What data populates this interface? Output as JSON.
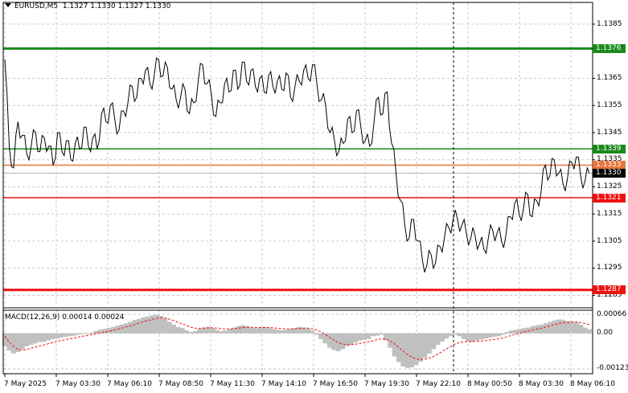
{
  "header": {
    "symbol": "EURUSD,M5",
    "ohlc": "1.1327 1.1330 1.1327 1.1330"
  },
  "macd": {
    "label": "MACD(12,26,9) 0.00014 0.00024",
    "ticks": [
      "0.00066",
      "0.00",
      "-0.00123"
    ]
  },
  "colors": {
    "background": "#ffffff",
    "price_line": "#000000",
    "support_resistance_green": "#1a8a1a",
    "support_resistance_red": "#ee1111",
    "current_price_badge": "#000000",
    "previous_price_line": "#e8743a",
    "macd_histogram": "#c0c0c0",
    "macd_signal": "#ee1111"
  },
  "chart_data": {
    "type": "line",
    "title": "EURUSD,M5",
    "ylim": [
      1.1281,
      1.1393
    ],
    "y_ticks": [
      "1.1385",
      "1.1365",
      "1.1355",
      "1.1345",
      "1.1335",
      "1.1325",
      "1.1315",
      "1.1305",
      "1.1295",
      "1.1285"
    ],
    "x_ticks": [
      "7 May 2025",
      "7 May 03:30",
      "7 May 06:10",
      "7 May 08:50",
      "7 May 11:30",
      "7 May 14:10",
      "7 May 16:50",
      "7 May 19:30",
      "7 May 22:10",
      "8 May 00:50",
      "8 May 03:30",
      "8 May 06:10"
    ],
    "grid": true,
    "levels": [
      {
        "value": 1.1376,
        "label": "1.1376",
        "color": "green",
        "thick": true
      },
      {
        "value": 1.1339,
        "label": "1.1339",
        "color": "green",
        "thick": false
      },
      {
        "value": 1.1333,
        "label": "1.1333",
        "color": "orange",
        "thick": false
      },
      {
        "value": 1.133,
        "label": "1.1330",
        "color": "black",
        "thick": false
      },
      {
        "value": 1.1321,
        "label": "1.1321",
        "color": "red",
        "thick": false
      },
      {
        "value": 1.1287,
        "label": "1.1287",
        "color": "red",
        "thick": true
      }
    ],
    "vline_index": 8,
    "series": [
      {
        "values": [
          1.1372,
          1.134,
          1.1332,
          1.1349,
          1.1344,
          1.1337,
          1.134,
          1.1345,
          1.1338,
          1.1343,
          1.134,
          1.1333,
          1.1345,
          1.1338,
          1.1342,
          1.1335,
          1.1341,
          1.1339,
          1.1347,
          1.134,
          1.1343,
          1.1339,
          1.1352,
          1.1349,
          1.1355,
          1.135,
          1.1346,
          1.1353,
          1.1356,
          1.1362,
          1.1358,
          1.1365,
          1.1368,
          1.1363,
          1.1366,
          1.1372,
          1.1366,
          1.1369,
          1.1361,
          1.1357,
          1.1358,
          1.1361,
          1.1352,
          1.1356,
          1.1364,
          1.137,
          1.1363,
          1.1359,
          1.1351,
          1.1356,
          1.1363,
          1.136,
          1.1368,
          1.1361,
          1.1371,
          1.1364,
          1.1368,
          1.1362,
          1.1365,
          1.136,
          1.1366,
          1.1362,
          1.1364,
          1.1361,
          1.1367,
          1.1358,
          1.1362,
          1.1364,
          1.1368,
          1.1365,
          1.137,
          1.1363,
          1.1357,
          1.1355,
          1.1345,
          1.1342,
          1.1338,
          1.1341,
          1.135,
          1.1345,
          1.1353,
          1.1347,
          1.1342,
          1.134,
          1.1349,
          1.1358,
          1.1352,
          1.136,
          1.1341,
          1.133,
          1.132,
          1.1311,
          1.1306,
          1.1313,
          1.1305,
          1.1298,
          1.1296,
          1.13,
          1.1297,
          1.1303,
          1.1306,
          1.131,
          1.1313,
          1.1313,
          1.1311,
          1.1308,
          1.1306,
          1.1307,
          1.1304,
          1.1302,
          1.1306,
          1.1309,
          1.1308,
          1.1305,
          1.1307,
          1.1314,
          1.1319,
          1.1315,
          1.1317,
          1.1322,
          1.1314,
          1.132,
          1.1323,
          1.1333,
          1.1329,
          1.1335,
          1.133,
          1.1326,
          1.1328,
          1.1334,
          1.1336,
          1.1329,
          1.1327,
          1.133
        ]
      }
    ],
    "macd": {
      "ylim": [
        -0.0014,
        0.0008
      ],
      "histogram": [
        -0.00045,
        -0.0006,
        -0.0007,
        -0.00065,
        -0.00055,
        -0.00045,
        -0.0004,
        -0.00035,
        -0.0003,
        -0.0003,
        -0.00025,
        -0.0002,
        -0.00018,
        -0.00015,
        -0.00012,
        -0.0001,
        -8e-05,
        -5e-05,
        -2e-05,
        0.0,
        3e-05,
        8e-05,
        0.00012,
        0.00015,
        0.00018,
        0.00022,
        0.00026,
        0.0003,
        0.00034,
        0.0004,
        0.00046,
        0.0005,
        0.00055,
        0.00058,
        0.00062,
        0.00064,
        0.0006,
        0.00052,
        0.0004,
        0.0003,
        0.00022,
        0.00018,
        0.0001,
        5e-05,
        8e-05,
        0.00015,
        0.0002,
        0.00022,
        0.00018,
        0.00012,
        8e-05,
        0.0001,
        0.00015,
        0.0002,
        0.00025,
        0.00028,
        0.00025,
        0.0002,
        0.00018,
        0.0002,
        0.00022,
        0.00018,
        0.00015,
        0.00012,
        0.0001,
        0.00012,
        0.00015,
        0.00018,
        0.00022,
        0.0002,
        0.00016,
        0.0001,
        -5e-05,
        -0.0002,
        -0.00035,
        -0.0005,
        -0.00058,
        -0.00062,
        -0.00055,
        -0.00045,
        -0.0004,
        -0.00032,
        -0.00025,
        -0.00022,
        -0.0002,
        -0.0001,
        -8e-05,
        -5e-05,
        -0.00025,
        -0.0005,
        -0.0008,
        -0.001,
        -0.00115,
        -0.0012,
        -0.00118,
        -0.0011,
        -0.00098,
        -0.00085,
        -0.0007,
        -0.00055,
        -0.0004,
        -0.00028,
        -0.00018,
        -0.0001,
        -5e-05,
        -0.0001,
        -0.0002,
        -0.00028,
        -0.0003,
        -0.00025,
        -0.00022,
        -0.00018,
        -0.00015,
        -0.00012,
        -0.0001,
        -5e-05,
        5e-05,
        0.0001,
        0.00012,
        0.00015,
        0.00018,
        0.0002,
        0.00025,
        0.00028,
        0.0003,
        0.00035,
        0.0004,
        0.00045,
        0.00048,
        0.00046,
        0.00042,
        0.0004,
        0.00038,
        0.0003,
        0.0002,
        0.00014
      ],
      "signal": [
        -0.0001,
        -0.0003,
        -0.00045,
        -0.00055,
        -0.00058,
        -0.00056,
        -0.00052,
        -0.00048,
        -0.00044,
        -0.0004,
        -0.00036,
        -0.00032,
        -0.00028,
        -0.00025,
        -0.00022,
        -0.00019,
        -0.00016,
        -0.00013,
        -0.0001,
        -8e-05,
        -5e-05,
        -2e-05,
        1e-05,
        4e-05,
        7e-05,
        0.0001,
        0.00014,
        0.00018,
        0.00022,
        0.00026,
        0.0003,
        0.00035,
        0.0004,
        0.00044,
        0.00048,
        0.00052,
        0.00054,
        0.00053,
        0.00049,
        0.00044,
        0.00038,
        0.00033,
        0.00027,
        0.00021,
        0.00018,
        0.00017,
        0.00018,
        0.00019,
        0.00019,
        0.00018,
        0.00016,
        0.00015,
        0.00015,
        0.00016,
        0.00018,
        0.0002,
        0.00021,
        0.00021,
        0.0002,
        0.0002,
        0.0002,
        0.0002,
        0.00019,
        0.00017,
        0.00016,
        0.00015,
        0.00015,
        0.00016,
        0.00017,
        0.00018,
        0.00018,
        0.00016,
        0.00012,
        5e-05,
        -4e-05,
        -0.00014,
        -0.00024,
        -0.00032,
        -0.00037,
        -0.00039,
        -0.00039,
        -0.00038,
        -0.00035,
        -0.00032,
        -0.0003,
        -0.00026,
        -0.00022,
        -0.00019,
        -0.0002,
        -0.00026,
        -0.00036,
        -0.00049,
        -0.00062,
        -0.00074,
        -0.00083,
        -0.00089,
        -0.00091,
        -0.0009,
        -0.00086,
        -0.0008,
        -0.00072,
        -0.00063,
        -0.00054,
        -0.00045,
        -0.00037,
        -0.00032,
        -0.00029,
        -0.00029,
        -0.00029,
        -0.00028,
        -0.00027,
        -0.00025,
        -0.00023,
        -0.00021,
        -0.00019,
        -0.00016,
        -0.00012,
        -7e-05,
        -3e-05,
        1e-05,
        5e-05,
        8e-05,
        0.00012,
        0.00015,
        0.00018,
        0.00022,
        0.00026,
        0.0003,
        0.00034,
        0.00037,
        0.00038,
        0.00039,
        0.00039,
        0.00037,
        0.00034,
        0.0003
      ]
    }
  }
}
